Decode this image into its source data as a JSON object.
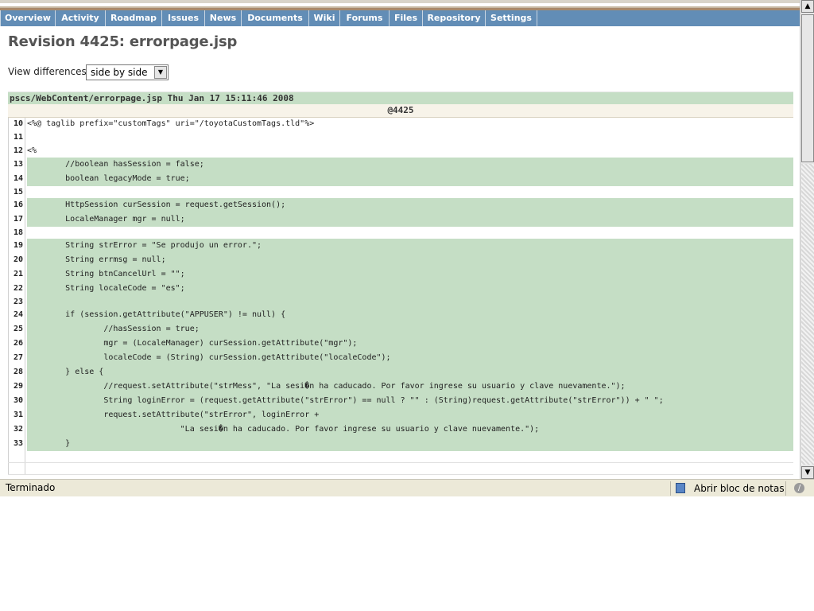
{
  "menu": {
    "items": [
      "Overview",
      "Activity",
      "Roadmap",
      "Issues",
      "News",
      "Documents",
      "Wiki",
      "Forums",
      "Files",
      "Repository",
      "Settings"
    ]
  },
  "page": {
    "title": "Revision 4425: errorpage.jsp",
    "view_label": "View differences",
    "view_selected": "side by side"
  },
  "diff": {
    "file_header": "pscs/WebContent/errorpage.jsp Thu Jan 17 15:11:46 2008",
    "revision": "@4425",
    "lines": [
      {
        "n": "10",
        "code": "<%@ taglib prefix=\"customTags\" uri=\"/toyotaCustomTags.tld\"%>",
        "changed": false
      },
      {
        "n": "11",
        "code": "",
        "changed": false
      },
      {
        "n": "12",
        "code": "<%",
        "changed": false
      },
      {
        "n": "13",
        "code": "        //boolean hasSession = false;",
        "changed": true
      },
      {
        "n": "14",
        "code": "        boolean legacyMode = true;",
        "changed": true
      },
      {
        "n": "15",
        "code": "",
        "changed": false
      },
      {
        "n": "16",
        "code": "        HttpSession curSession = request.getSession();",
        "changed": true
      },
      {
        "n": "17",
        "code": "        LocaleManager mgr = null;",
        "changed": true
      },
      {
        "n": "18",
        "code": "",
        "changed": false
      },
      {
        "n": "19",
        "code": "        String strError = \"Se produjo un error.\";",
        "changed": true
      },
      {
        "n": "20",
        "code": "        String errmsg = null;",
        "changed": true
      },
      {
        "n": "21",
        "code": "        String btnCancelUrl = \"\";",
        "changed": true
      },
      {
        "n": "22",
        "code": "        String localeCode = \"es\";",
        "changed": true
      },
      {
        "n": "23",
        "code": "",
        "changed": true
      },
      {
        "n": "24",
        "code": "        if (session.getAttribute(\"APPUSER\") != null) {",
        "changed": true
      },
      {
        "n": "25",
        "code": "                //hasSession = true;",
        "changed": true
      },
      {
        "n": "26",
        "code": "                mgr = (LocaleManager) curSession.getAttribute(\"mgr\");",
        "changed": true
      },
      {
        "n": "27",
        "code": "                localeCode = (String) curSession.getAttribute(\"localeCode\");",
        "changed": true
      },
      {
        "n": "28",
        "code": "        } else {",
        "changed": true
      },
      {
        "n": "29",
        "code": "                //request.setAttribute(\"strMess\", \"La sesi�n ha caducado. Por favor ingrese su usuario y clave nuevamente.\");",
        "changed": true
      },
      {
        "n": "30",
        "code": "                String loginError = (request.getAttribute(\"strError\") == null ? \"\" : (String)request.getAttribute(\"strError\")) + \" \";",
        "changed": true
      },
      {
        "n": "31",
        "code": "                request.setAttribute(\"strError\", loginError +",
        "changed": true
      },
      {
        "n": "32",
        "code": "                                \"La sesi�n ha caducado. Por favor ingrese su usuario y clave nuevamente.\");",
        "changed": true
      },
      {
        "n": "33",
        "code": "        }",
        "changed": true
      }
    ]
  },
  "status": {
    "text": "Terminado",
    "notes_label": "Abrir bloc de notas"
  },
  "colors": {
    "menu_bg": "#628db6",
    "changed_bg": "#c5dec5"
  }
}
